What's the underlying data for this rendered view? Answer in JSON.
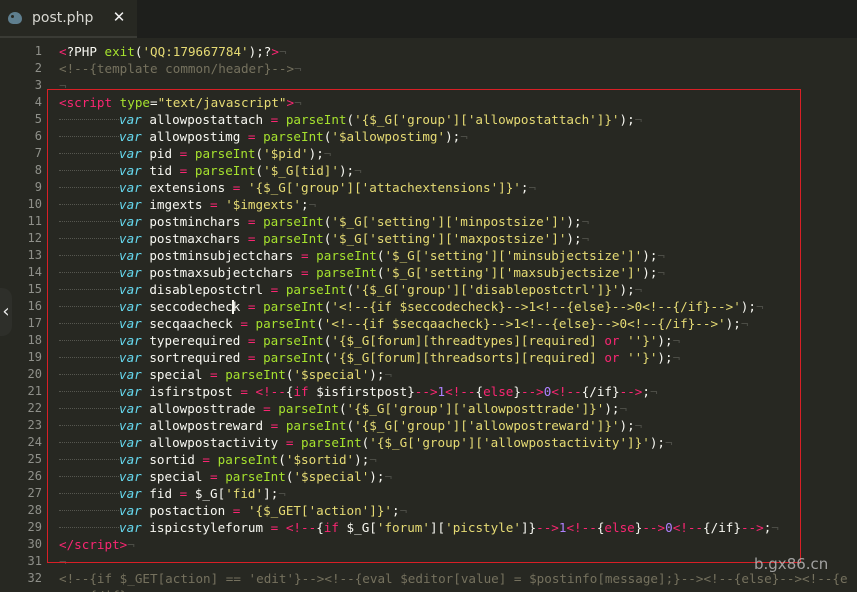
{
  "tab": {
    "title": "post.php",
    "close_label": "✕",
    "icon": "php-elephant-icon"
  },
  "lines": [
    {
      "n": "1",
      "h": "<span class=\"t\">&lt;</span>?PHP <span class=\"f\">exit</span>(<span class=\"s\">'QQ:179667784'</span>);?<span class=\"t\">&gt;</span><span class=\"eol\">¬</span>"
    },
    {
      "n": "2",
      "h": "<span class=\"c\">&lt;!--{template common/header}--&gt;</span><span class=\"eol\">¬</span>"
    },
    {
      "n": "3",
      "h": "<span class=\"eol\">¬</span>"
    },
    {
      "n": "4",
      "h": "<span class=\"t\">&lt;script</span> <span class=\"a\">type</span>=<span class=\"s\">\"text/javascript\"</span><span class=\"t\">&gt;</span><span class=\"eol\">¬</span>"
    },
    {
      "n": "5",
      "h": "TAB<span class=\"k\">var</span> allowpostattach <span class=\"o\">=</span> <span class=\"f\">parseInt</span>(<span class=\"s\">'{$_G['group']['allowpostattach']}'</span>);<span class=\"eol\">¬</span>"
    },
    {
      "n": "6",
      "h": "TAB<span class=\"k\">var</span> allowpostimg <span class=\"o\">=</span> <span class=\"f\">parseInt</span>(<span class=\"s\">'$allowpostimg'</span>);<span class=\"eol\">¬</span>"
    },
    {
      "n": "7",
      "h": "TAB<span class=\"k\">var</span> pid <span class=\"o\">=</span> <span class=\"f\">parseInt</span>(<span class=\"s\">'$pid'</span>);<span class=\"eol\">¬</span>"
    },
    {
      "n": "8",
      "h": "TAB<span class=\"k\">var</span> tid <span class=\"o\">=</span> <span class=\"f\">parseInt</span>(<span class=\"s\">'$_G[tid]'</span>);<span class=\"eol\">¬</span>"
    },
    {
      "n": "9",
      "h": "TAB<span class=\"k\">var</span> extensions <span class=\"o\">=</span> <span class=\"s\">'{$_G['group']['attachextensions']}'</span>;<span class=\"eol\">¬</span>"
    },
    {
      "n": "10",
      "h": "TAB<span class=\"k\">var</span> imgexts <span class=\"o\">=</span> <span class=\"s\">'$imgexts'</span>;<span class=\"eol\">¬</span>"
    },
    {
      "n": "11",
      "h": "TAB<span class=\"k\">var</span> postminchars <span class=\"o\">=</span> <span class=\"f\">parseInt</span>(<span class=\"s\">'$_G['setting']['minpostsize']'</span>);<span class=\"eol\">¬</span>"
    },
    {
      "n": "12",
      "h": "TAB<span class=\"k\">var</span> postmaxchars <span class=\"o\">=</span> <span class=\"f\">parseInt</span>(<span class=\"s\">'$_G['setting']['maxpostsize']'</span>);<span class=\"eol\">¬</span>"
    },
    {
      "n": "13",
      "h": "TAB<span class=\"k\">var</span> postminsubjectchars <span class=\"o\">=</span> <span class=\"f\">parseInt</span>(<span class=\"s\">'$_G['setting']['minsubjectsize']'</span>);<span class=\"eol\">¬</span>"
    },
    {
      "n": "14",
      "h": "TAB<span class=\"k\">var</span> postmaxsubjectchars <span class=\"o\">=</span> <span class=\"f\">parseInt</span>(<span class=\"s\">'$_G['setting']['maxsubjectsize']'</span>);<span class=\"eol\">¬</span>"
    },
    {
      "n": "15",
      "h": "TAB<span class=\"k\">var</span> disablepostctrl <span class=\"o\">=</span> <span class=\"f\">parseInt</span>(<span class=\"s\">'{$_G['group']['disablepostctrl']}'</span>);<span class=\"eol\">¬</span>"
    },
    {
      "n": "16",
      "h": "TAB<span class=\"k\">var</span> seccodecheck <span class=\"o\">=</span> <span class=\"f\">parseInt</span>(<span class=\"s\">'&lt;!--{if $seccodecheck}--&gt;1&lt;!--{else}--&gt;0&lt;!--{/if}--&gt;'</span>);<span class=\"eol\">¬</span>"
    },
    {
      "n": "17",
      "h": "TAB<span class=\"k\">var</span> secqaacheck <span class=\"o\">=</span> <span class=\"f\">parseInt</span>(<span class=\"s\">'&lt;!--{if $secqaacheck}--&gt;1&lt;!--{else}--&gt;0&lt;!--{/if}--&gt;'</span>);<span class=\"eol\">¬</span>"
    },
    {
      "n": "18",
      "h": "TAB<span class=\"k\">var</span> typerequired <span class=\"o\">=</span> <span class=\"f\">parseInt</span>(<span class=\"s\">'{$_G[forum][threadtypes][required] </span><span class=\"o\">or</span><span class=\"s\"> ''}'</span>);<span class=\"eol\">¬</span>"
    },
    {
      "n": "19",
      "h": "TAB<span class=\"k\">var</span> sortrequired <span class=\"o\">=</span> <span class=\"f\">parseInt</span>(<span class=\"s\">'{$_G[forum][threadsorts][required] </span><span class=\"o\">or</span><span class=\"s\"> ''}'</span>);<span class=\"eol\">¬</span>"
    },
    {
      "n": "20",
      "h": "TAB<span class=\"k\">var</span> special <span class=\"o\">=</span> <span class=\"f\">parseInt</span>(<span class=\"s\">'$special'</span>);<span class=\"eol\">¬</span>"
    },
    {
      "n": "21",
      "h": "TAB<span class=\"k\">var</span> isfirstpost <span class=\"o\">=</span> <span class=\"o\">&lt;!--</span>{<span class=\"o\">if</span> $isfirstpost}<span class=\"o\">--&gt;</span><span class=\"n\">1</span><span class=\"o\">&lt;!--</span>{<span class=\"o\">else</span>}<span class=\"o\">--&gt;</span><span class=\"n\">0</span><span class=\"o\">&lt;!--</span>{/if}<span class=\"o\">--&gt;</span>;<span class=\"eol\">¬</span>"
    },
    {
      "n": "22",
      "h": "TAB<span class=\"k\">var</span> allowposttrade <span class=\"o\">=</span> <span class=\"f\">parseInt</span>(<span class=\"s\">'{$_G['group']['allowposttrade']}'</span>);<span class=\"eol\">¬</span>"
    },
    {
      "n": "23",
      "h": "TAB<span class=\"k\">var</span> allowpostreward <span class=\"o\">=</span> <span class=\"f\">parseInt</span>(<span class=\"s\">'{$_G['group']['allowpostreward']}'</span>);<span class=\"eol\">¬</span>"
    },
    {
      "n": "24",
      "h": "TAB<span class=\"k\">var</span> allowpostactivity <span class=\"o\">=</span> <span class=\"f\">parseInt</span>(<span class=\"s\">'{$_G['group']['allowpostactivity']}'</span>);<span class=\"eol\">¬</span>"
    },
    {
      "n": "25",
      "h": "TAB<span class=\"k\">var</span> sortid <span class=\"o\">=</span> <span class=\"f\">parseInt</span>(<span class=\"s\">'$sortid'</span>);<span class=\"eol\">¬</span>"
    },
    {
      "n": "26",
      "h": "TAB<span class=\"k\">var</span> special <span class=\"o\">=</span> <span class=\"f\">parseInt</span>(<span class=\"s\">'$special'</span>);<span class=\"eol\">¬</span>"
    },
    {
      "n": "27",
      "h": "TAB<span class=\"k\">var</span> fid <span class=\"o\">=</span> $_G[<span class=\"s\">'fid'</span>];<span class=\"eol\">¬</span>"
    },
    {
      "n": "28",
      "h": "TAB<span class=\"k\">var</span> postaction <span class=\"o\">=</span> <span class=\"s\">'{$_GET['action']}'</span>;<span class=\"eol\">¬</span>"
    },
    {
      "n": "29",
      "h": "TAB<span class=\"k\">var</span> ispicstyleforum <span class=\"o\">=</span> <span class=\"o\">&lt;!--</span>{<span class=\"o\">if</span> $_G[<span class=\"s\">'forum'</span>][<span class=\"s\">'picstyle'</span>]}<span class=\"o\">--&gt;</span><span class=\"n\">1</span><span class=\"o\">&lt;!--</span>{<span class=\"o\">else</span>}<span class=\"o\">--&gt;</span><span class=\"n\">0</span><span class=\"o\">&lt;!--</span>{/if}<span class=\"o\">--&gt;</span>;<span class=\"eol\">¬</span>"
    },
    {
      "n": "30",
      "h": "<span class=\"t\">&lt;/script&gt;</span><span class=\"eol\">¬</span>"
    },
    {
      "n": "31",
      "h": "<span class=\"eol\">¬</span>"
    },
    {
      "n": "32",
      "h": "<span class=\"c\">&lt;!--{if $_GET[action] == 'edit'}--&gt;&lt;!--{eval $editor[value] = $postinfo[message];}--&gt;&lt;!--{else}--&gt;&lt;!--{e</span>"
    },
    {
      "n": "",
      "h": "<span class=\"c\">    {/if}--&gt;</span>"
    }
  ],
  "watermark": "b.gx86.cn"
}
